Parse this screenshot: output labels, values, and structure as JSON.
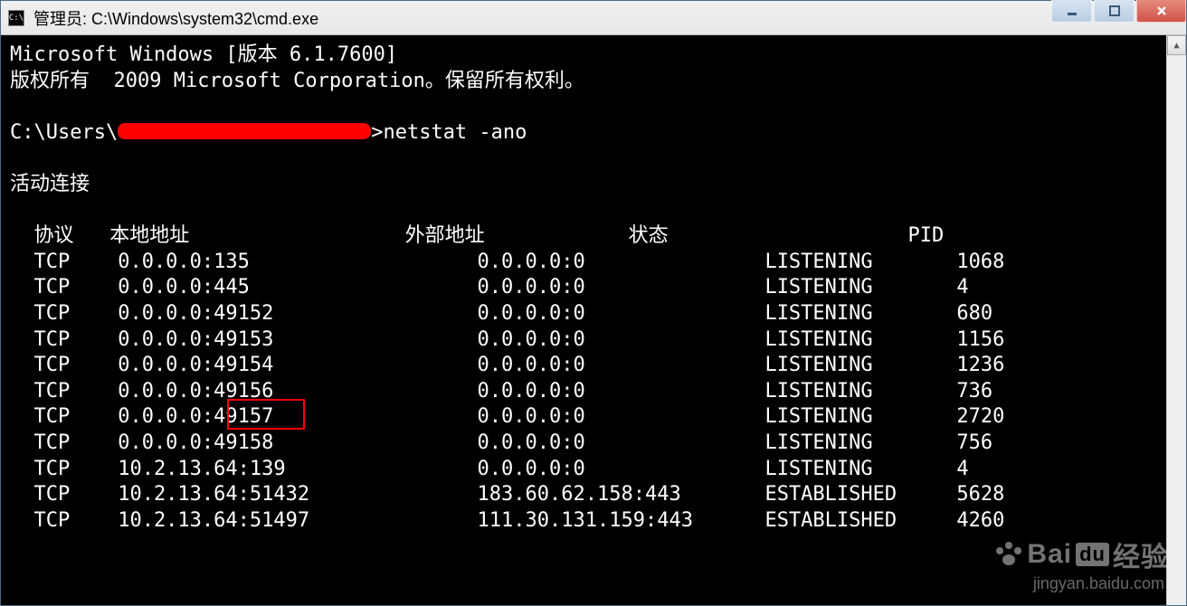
{
  "title": "管理员: C:\\Windows\\system32\\cmd.exe",
  "app_icon_text": "C:\\",
  "header1": "Microsoft Windows [版本 6.1.7600]",
  "header2_a": "版权所有 <c> 2009 Microsoft Corporation。",
  "header2_b": "保留所有权利。",
  "prompt_prefix": "C:\\Users\\",
  "prompt_cmd": ">netstat -ano",
  "section": "活动连接",
  "cols": {
    "proto": "协议",
    "local": "本地地址",
    "foreign": "外部地址",
    "state": "状态",
    "pid": "PID"
  },
  "rows": [
    {
      "proto": "TCP",
      "local": "0.0.0.0:135",
      "foreign": "0.0.0.0:0",
      "state": "LISTENING",
      "pid": "1068"
    },
    {
      "proto": "TCP",
      "local": "0.0.0.0:445",
      "foreign": "0.0.0.0:0",
      "state": "LISTENING",
      "pid": "4"
    },
    {
      "proto": "TCP",
      "local": "0.0.0.0:49152",
      "foreign": "0.0.0.0:0",
      "state": "LISTENING",
      "pid": "680"
    },
    {
      "proto": "TCP",
      "local": "0.0.0.0:49153",
      "foreign": "0.0.0.0:0",
      "state": "LISTENING",
      "pid": "1156"
    },
    {
      "proto": "TCP",
      "local": "0.0.0.0:49154",
      "foreign": "0.0.0.0:0",
      "state": "LISTENING",
      "pid": "1236"
    },
    {
      "proto": "TCP",
      "local": "0.0.0.0:49156",
      "foreign": "0.0.0.0:0",
      "state": "LISTENING",
      "pid": "736"
    },
    {
      "proto": "TCP",
      "local": "0.0.0.0:49157",
      "foreign": "0.0.0.0:0",
      "state": "LISTENING",
      "pid": "2720"
    },
    {
      "proto": "TCP",
      "local": "0.0.0.0:49158",
      "foreign": "0.0.0.0:0",
      "state": "LISTENING",
      "pid": "756"
    },
    {
      "proto": "TCP",
      "local": "10.2.13.64:139",
      "foreign": "0.0.0.0:0",
      "state": "LISTENING",
      "pid": "4"
    },
    {
      "proto": "TCP",
      "local": "10.2.13.64:51432",
      "foreign": "183.60.62.158:443",
      "state": "ESTABLISHED",
      "pid": "5628"
    },
    {
      "proto": "TCP",
      "local": "10.2.13.64:51497",
      "foreign": "111.30.131.159:443",
      "state": "ESTABLISHED",
      "pid": "4260"
    }
  ],
  "highlight_port": "49157",
  "watermark_main": "Bai",
  "watermark_du": "du",
  "watermark_tail": "经验",
  "watermark_sub": "jingyan.baidu.com"
}
